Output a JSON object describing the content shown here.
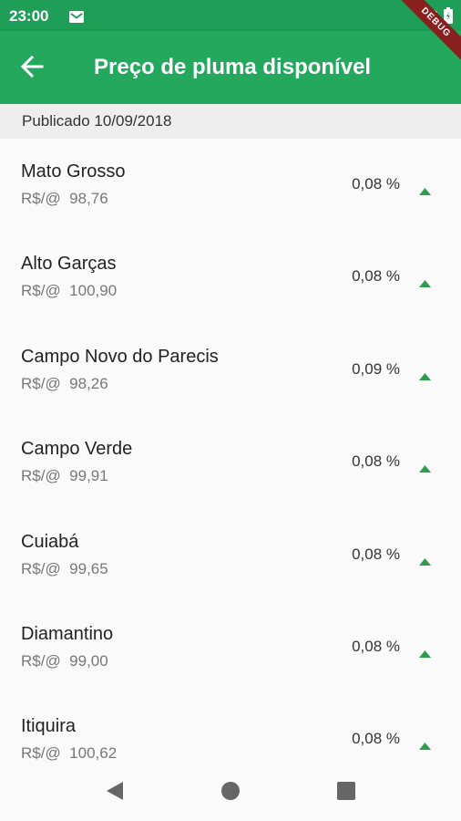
{
  "status": {
    "time": "23:00",
    "icons": [
      "mail-icon",
      "wifi-icon",
      "battery-icon"
    ],
    "debug_label": "DEBUG"
  },
  "app_bar": {
    "title": "Preço de pluma disponível",
    "back_icon": "arrow-back-icon",
    "color": "#24a85e"
  },
  "published": "Publicado 10/09/2018",
  "items": [
    {
      "name": "Mato Grosso",
      "price": "R$/@  98,76",
      "change": "0,08 %",
      "trend": "up"
    },
    {
      "name": "Alto Garças",
      "price": "R$/@  100,90",
      "change": "0,08 %",
      "trend": "up"
    },
    {
      "name": "Campo Novo do Parecis",
      "price": "R$/@  98,26",
      "change": "0,09 %",
      "trend": "up"
    },
    {
      "name": "Campo Verde",
      "price": "R$/@  99,91",
      "change": "0,08 %",
      "trend": "up"
    },
    {
      "name": "Cuiabá",
      "price": "R$/@  99,65",
      "change": "0,08 %",
      "trend": "up"
    },
    {
      "name": "Diamantino",
      "price": "R$/@  99,00",
      "change": "0,08 %",
      "trend": "up"
    },
    {
      "name": "Itiquira",
      "price": "R$/@  100,62",
      "change": "0,08 %",
      "trend": "up"
    }
  ],
  "colors": {
    "trend_up": "#2e9e4e",
    "status_bar": "#1e9e57"
  },
  "nav": [
    "nav-back-icon",
    "nav-home-icon",
    "nav-recents-icon"
  ]
}
